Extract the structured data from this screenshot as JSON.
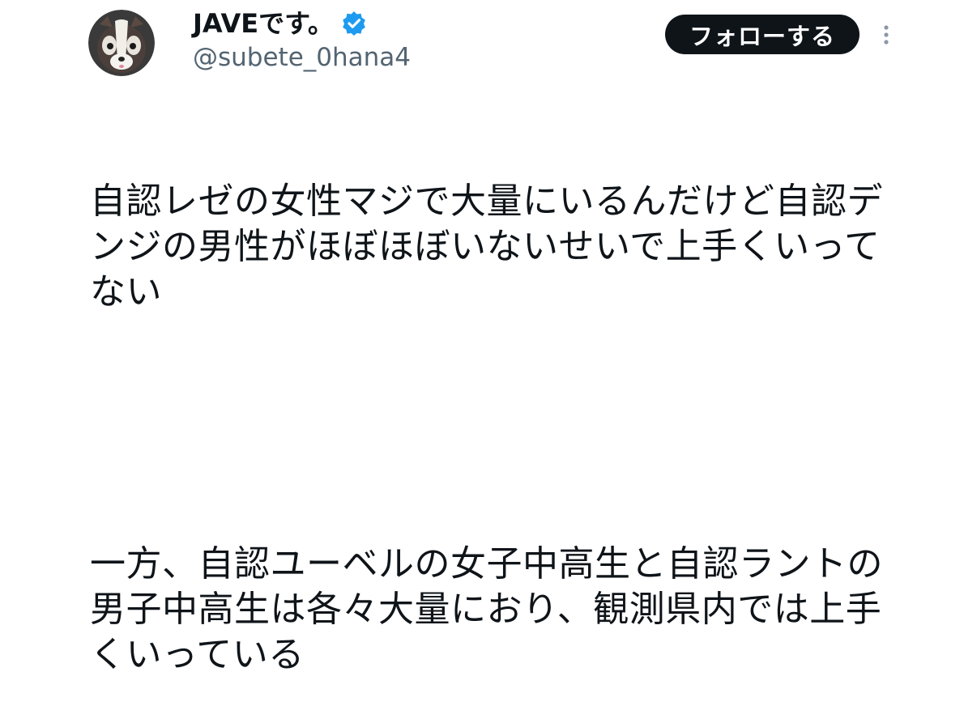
{
  "author": {
    "display_name": "JAVEです。",
    "handle": "@subete_0hana4",
    "verified_icon": "verified-badge-icon",
    "avatar_icon": "skunk-avatar"
  },
  "actions": {
    "follow_label": "フォローする",
    "more_icon": "more-vertical-icon"
  },
  "tweet": {
    "paragraph1": "自認レゼの女性マジで大量にいるんだけど自認デンジの男性がほぼほぼいないせいで上手くいってない",
    "paragraph2": "一方、自認ユーベルの女子中高生と自認ラントの男子中高生は各々大量におり、観測県内では上手くいっている"
  },
  "colors": {
    "follow_bg": "#0f1419",
    "handle": "#536471",
    "verified": "#1d9bf0"
  }
}
